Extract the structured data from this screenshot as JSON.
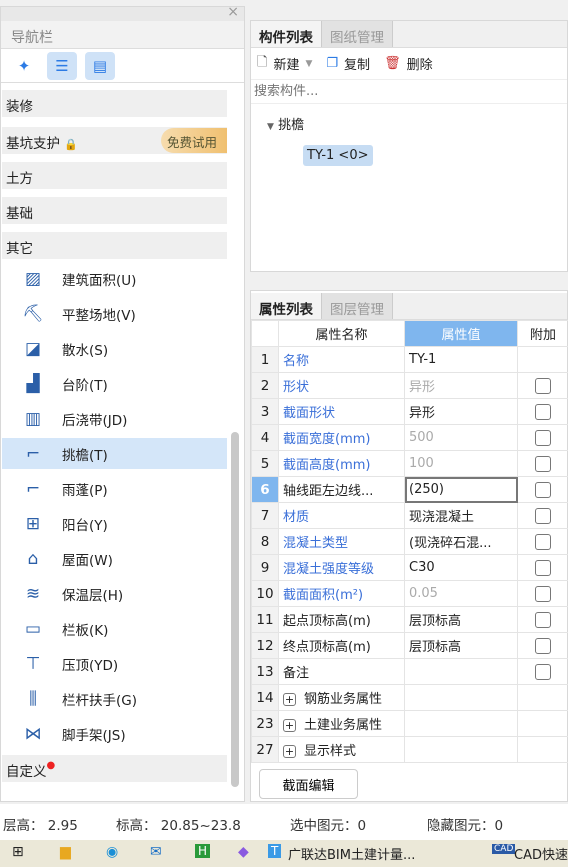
{
  "nav": {
    "title": "导航栏",
    "close": "×",
    "categories": [
      {
        "label": "装修"
      },
      {
        "label": "基坑支护",
        "badge": "免费试用"
      },
      {
        "label": "土方"
      },
      {
        "label": "基础"
      },
      {
        "label": "其它"
      }
    ],
    "items": [
      {
        "label": "建筑面积(U)",
        "icon": "area-icon"
      },
      {
        "label": "平整场地(V)",
        "icon": "level-site-icon"
      },
      {
        "label": "散水(S)",
        "icon": "apron-icon"
      },
      {
        "label": "台阶(T)",
        "icon": "steps-icon"
      },
      {
        "label": "后浇带(JD)",
        "icon": "post-cast-strip-icon"
      },
      {
        "label": "挑檐(T)",
        "icon": "cornice-icon",
        "selected": true
      },
      {
        "label": "雨蓬(P)",
        "icon": "canopy-icon"
      },
      {
        "label": "阳台(Y)",
        "icon": "balcony-icon"
      },
      {
        "label": "屋面(W)",
        "icon": "roof-icon"
      },
      {
        "label": "保温层(H)",
        "icon": "insulation-icon"
      },
      {
        "label": "栏板(K)",
        "icon": "parapet-icon"
      },
      {
        "label": "压顶(YD)",
        "icon": "coping-icon"
      },
      {
        "label": "栏杆扶手(G)",
        "icon": "railing-icon"
      },
      {
        "label": "脚手架(JS)",
        "icon": "scaffold-icon"
      }
    ],
    "custom": "自定义"
  },
  "components": {
    "tabs": [
      "构件列表",
      "图纸管理"
    ],
    "new": "新建",
    "copy": "复制",
    "delete": "删除",
    "search_placeholder": "搜索构件...",
    "tree_group": "挑檐",
    "tree_item": "TY-1 <0>"
  },
  "properties": {
    "tabs": [
      "属性列表",
      "图层管理"
    ],
    "headers": [
      "属性名称",
      "属性值",
      "附加"
    ],
    "rows": [
      {
        "n": "1",
        "name": "名称",
        "value": "TY-1",
        "style": "blue",
        "chk": false
      },
      {
        "n": "2",
        "name": "形状",
        "value": "异形",
        "style": "blue",
        "vstyle": "gray",
        "chk": true
      },
      {
        "n": "3",
        "name": "截面形状",
        "value": "异形",
        "style": "blue",
        "chk": true
      },
      {
        "n": "4",
        "name": "截面宽度(mm)",
        "value": "500",
        "style": "blue",
        "vstyle": "gray",
        "chk": true
      },
      {
        "n": "5",
        "name": "截面高度(mm)",
        "value": "100",
        "style": "blue",
        "vstyle": "gray",
        "chk": true
      },
      {
        "n": "6",
        "name": "轴线距左边线...",
        "value": "(250)",
        "chk": true,
        "selected": true
      },
      {
        "n": "7",
        "name": "材质",
        "value": "现浇混凝土",
        "style": "blue",
        "chk": true
      },
      {
        "n": "8",
        "name": "混凝土类型",
        "value": "(现浇碎石混...",
        "style": "blue",
        "chk": true
      },
      {
        "n": "9",
        "name": "混凝土强度等级",
        "value": "C30",
        "style": "blue",
        "chk": true
      },
      {
        "n": "10",
        "name": "截面面积(m²)",
        "value": "0.05",
        "style": "blue",
        "vstyle": "gray",
        "chk": true
      },
      {
        "n": "11",
        "name": "起点顶标高(m)",
        "value": "层顶标高",
        "chk": true
      },
      {
        "n": "12",
        "name": "终点顶标高(m)",
        "value": "层顶标高",
        "chk": true
      },
      {
        "n": "13",
        "name": "备注",
        "value": "",
        "chk": true
      },
      {
        "n": "14",
        "name": "钢筋业务属性",
        "value": "",
        "group": true
      },
      {
        "n": "23",
        "name": "土建业务属性",
        "value": "",
        "group": true
      },
      {
        "n": "27",
        "name": "显示样式",
        "value": "",
        "group": true
      }
    ],
    "edit_button": "截面编辑"
  },
  "status": {
    "floor_height": "层高：  2.95",
    "elevation": "标高：  20.85~23.8",
    "selected": "选中图元：0",
    "hidden": "隐藏图元：0"
  },
  "taskbar": {
    "app1": "广联达BIM土建计量...",
    "app2": "CAD快速"
  }
}
